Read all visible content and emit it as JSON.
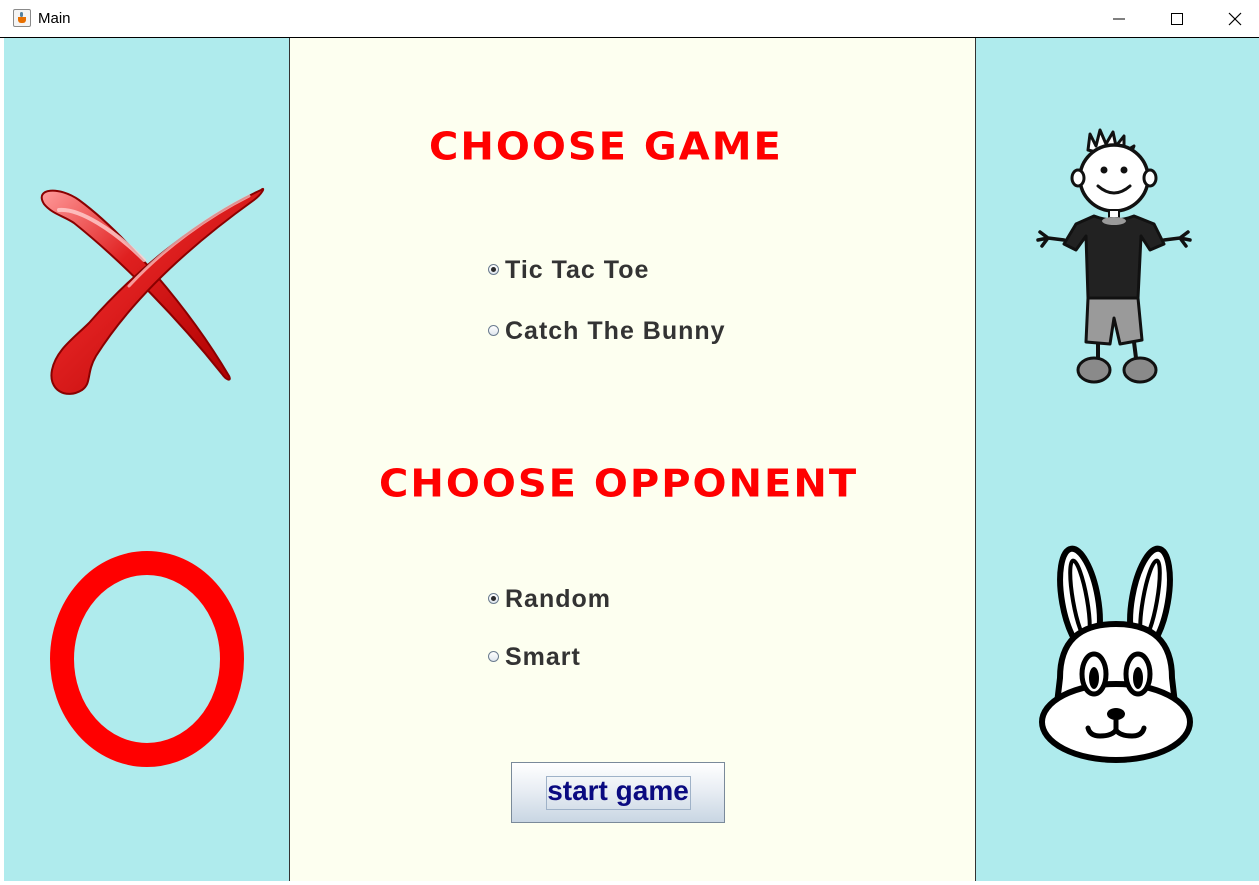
{
  "window": {
    "title": "Main"
  },
  "menu": {
    "choose_game_heading": "CHOOSE GAME",
    "games": [
      {
        "label": "Tic Tac Toe",
        "selected": true
      },
      {
        "label": "Catch The Bunny",
        "selected": false
      }
    ],
    "choose_opponent_heading": "CHOOSE OPPONENT",
    "opponents": [
      {
        "label": "Random",
        "selected": true
      },
      {
        "label": "Smart",
        "selected": false
      }
    ],
    "start_button_label": "start game"
  },
  "colors": {
    "side_panel_bg": "#afebed",
    "center_panel_bg": "#fdfff0",
    "heading_color": "#ff0000",
    "button_text": "#0a0a80"
  },
  "icons": {
    "left_top": "red-x-icon",
    "left_bottom": "red-o-icon",
    "right_top": "stick-boy-icon",
    "right_bottom": "bunny-icon"
  }
}
